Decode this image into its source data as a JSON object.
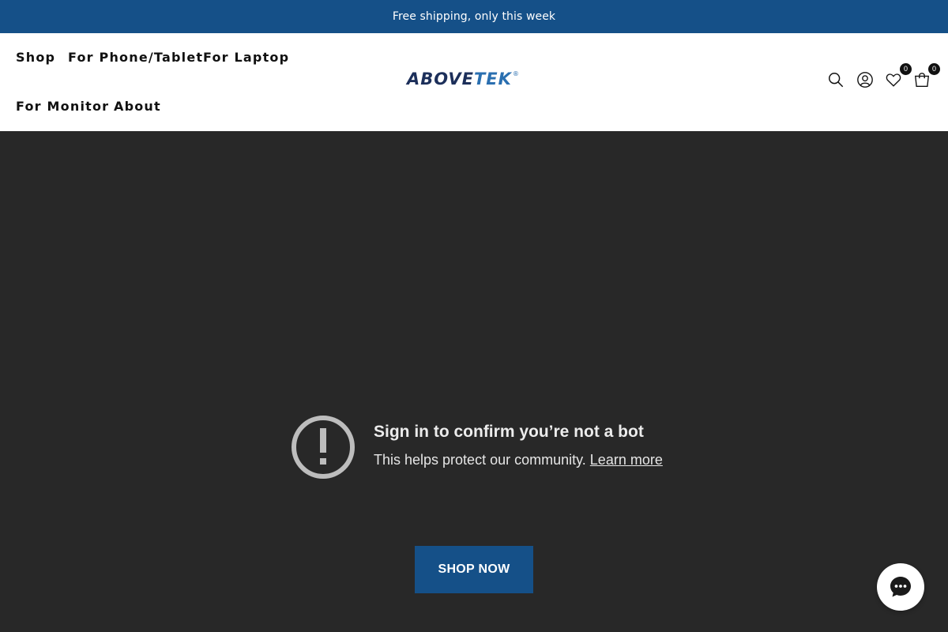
{
  "announcement": {
    "text": "Free shipping, only this week"
  },
  "nav": {
    "items": [
      {
        "label": "Shop"
      },
      {
        "label": "For Phone/Tablet"
      },
      {
        "label": "For Laptop"
      },
      {
        "label": "For Monitor"
      },
      {
        "label": "About"
      }
    ]
  },
  "logo": {
    "text_main": "ABOVE",
    "text_accent": "TEK",
    "mark": "®"
  },
  "header_icons": {
    "search": "search-icon",
    "account": "user-icon",
    "wishlist": "heart-icon",
    "cart": "cart-icon",
    "wishlist_count": "0",
    "cart_count": "0"
  },
  "notice": {
    "icon": "alert-circle-icon",
    "title": "Sign in to confirm you’re not a bot",
    "body": "This helps protect our community.",
    "link": "Learn more"
  },
  "cta": {
    "label": "SHOP NOW"
  },
  "chat": {
    "icon": "chat-bubble-icon"
  },
  "colors": {
    "brand_blue": "#155088",
    "page_background": "#282828",
    "header_background": "#ffffff",
    "badge": "#111111"
  }
}
